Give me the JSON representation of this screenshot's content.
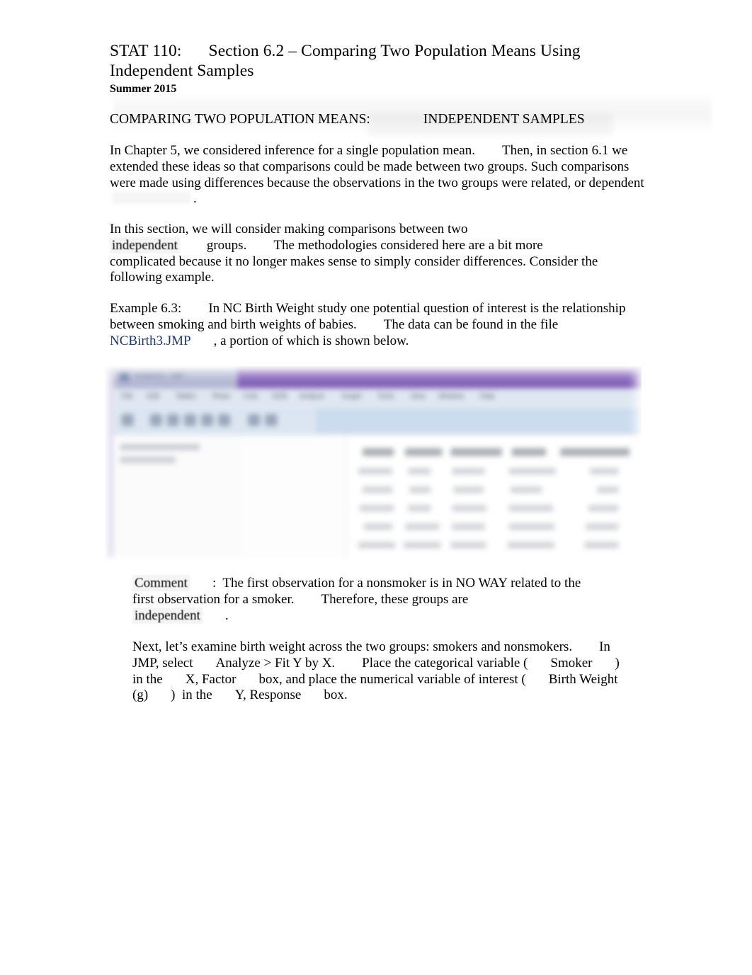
{
  "document": {
    "course": "STAT 110:",
    "section_title": "Section 6.2 – Comparing Two Population Means Using Independent Samples",
    "term": "Summer 2015",
    "heading_left": "COMPARING TWO POPULATION MEANS:",
    "heading_right": "INDEPENDENT SAMPLES"
  },
  "paragraphs": {
    "p1_a": "In Chapter 5, we considered inference for a single population mean.",
    "p1_b": "Then, in section 6.1 we extended these ideas so that comparisons could be made between two groups. Such comparisons were made using differences because the observations in the two groups were related, or dependent",
    "p1_period": ".",
    "p2_a": "In this section, we will consider making comparisons between two",
    "p2_highlight": "independent",
    "p2_b": "groups.",
    "p2_c": "The methodologies considered here are a bit more complicated because it no longer makes sense to simply consider differences. Consider the following example.",
    "p3_label": "Example 6.3:",
    "p3_a": "In NC Birth Weight study one potential question of interest is the relationship between smoking and birth weights of babies.",
    "p3_b": "The data can be found in the file",
    "p3_link": "NCBirth3.JMP",
    "p3_c": ", a portion of which is shown below.",
    "p4_label": "Comment",
    "p4_colon": ":",
    "p4_a": "The first observation for a nonsmoker is in NO WAY related to the first observation for a smoker.",
    "p4_b": "Therefore, these groups are",
    "p4_highlight": "independent",
    "p4_period": ".",
    "p5_a": "Next, let’s examine birth weight across the two groups: smokers and nonsmokers.",
    "p5_b": "In JMP, select",
    "p5_menu": "Analyze > Fit Y by X.",
    "p5_c": "Place the categorical variable (",
    "p5_var_x": "Smoker",
    "p5_d": ") in the",
    "p5_box_x": "X, Factor",
    "p5_e": "box, and place the numerical variable of interest (",
    "p5_var_y": "Birth Weight (g)",
    "p5_f": ")  in the",
    "p5_box_y": "Y, Response",
    "p5_g": "box."
  },
  "figure": {
    "caption_alt": "Blurred screenshot of the JMP data table window for NCBirth3.JMP",
    "window_title": "NCBirth3 - JMP",
    "menus": [
      "File",
      "Edit",
      "Tables",
      "Rows",
      "Cols",
      "DOE",
      "Analyze",
      "Graph",
      "Tools",
      "View",
      "Window",
      "Help"
    ],
    "columns": [
      "Plural",
      "Sex",
      "MomAge",
      "Weeks",
      "Marital",
      "RaceMom",
      "Smoke",
      "Birth Weight (g)"
    ]
  },
  "colors": {
    "link": "#1f3864",
    "title_bar_purple": "#7f5cb5",
    "toolbar_blue": "#dce6f2",
    "highlight_grey": "rgba(0,0,0,0.045)",
    "text": "#000000"
  }
}
